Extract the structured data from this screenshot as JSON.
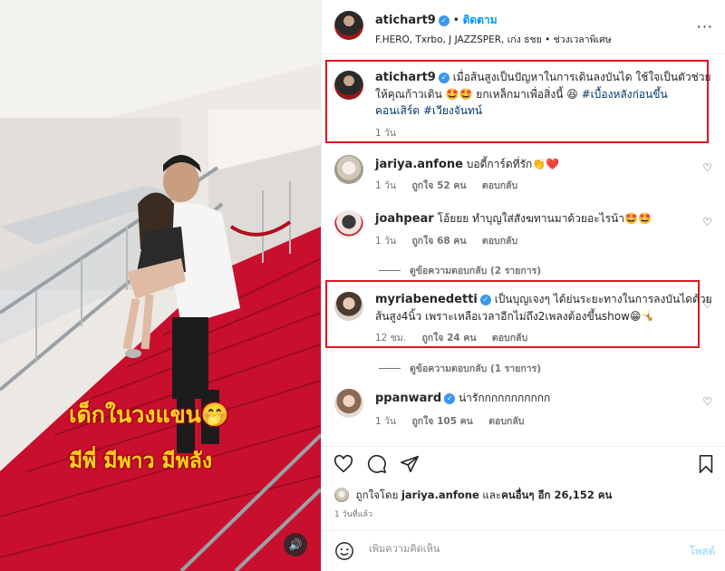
{
  "media": {
    "caption_line1": "เด็กในวงแขน🤭",
    "caption_line2": "มีพี่ มีพาว มีพลัง",
    "mute_icon": "🔊"
  },
  "post": {
    "author": "atichart9",
    "follow_label": "ติดตาม",
    "more_label": "···",
    "audio": "F.HERO, Txrbo, J JAZZSPER, เก่ง ธชย • ช่วงเวลาพิเศษ",
    "caption_author": "atichart9",
    "caption_line1": "เมื่อส้นสูงเป็นปัญหาในการเดินลงบันได ใช้ใจเป็นตัวช่วย",
    "caption_line2": "ให้คุณก้าวเดิน 🤩🤩 ยกเหล็กมาเพื่อสิ่งนี้ 😆",
    "caption_tag1": "#เบื้องหลังก่อนขึ้น",
    "caption_line3_prefix": "คอนเสิร์ต",
    "caption_tag2": "#เวียงจันทน์",
    "caption_time": "1 วัน"
  },
  "comments": [
    {
      "user": "jariya.anfone",
      "text": "บอดี้การ์ดที่รัก👏❤️",
      "time": "1 วัน",
      "likes": "ถูกใจ 52 คน",
      "reply": "ตอบกลับ"
    },
    {
      "user": "joahpear",
      "text": "โอ้ยยย ทำบุญใส่สังฆทานมาด้วยอะไรน้า🤩🤩",
      "time": "1 วัน",
      "likes": "ถูกใจ 68 คน",
      "reply": "ตอบกลับ",
      "view_replies": "ดูข้อความตอบกลับ (2 รายการ)"
    },
    {
      "user": "myriabenedetti",
      "text_line1": "เป็นบุญเจงๆ ได้ย่นระยะทางในการลงบันไดด้วย",
      "text_line2": "ส้นสูง4นิ้ว เพราะเหลือเวลาอีกไม่ถึง2เพลงต้องขึ้นshow😁🤸",
      "time": "12 ชม.",
      "likes": "ถูกใจ 24 คน",
      "reply": "ตอบกลับ",
      "view_replies": "ดูข้อความตอบกลับ (1 รายการ)"
    },
    {
      "user": "ppanward",
      "text": "น่ารักกกกกกกกกกก",
      "time": "1 วัน",
      "likes": "ถูกใจ 105 คน",
      "reply": "ตอบกลับ"
    }
  ],
  "footer": {
    "liked_by_prefix": "ถูกใจโดย",
    "liked_by_user": "jariya.anfone",
    "liked_by_and": "และ",
    "liked_by_others": "คนอื่นๆ อีก 26,152 คน",
    "date": "1 วันที่แล้ว",
    "comment_placeholder": "เพิ่มความคิดเห็น",
    "post_label": "โพสต์"
  },
  "colors": {
    "accent": "#0095f6",
    "highlight_box": "#e1141e",
    "carpet": "#c8102e"
  }
}
